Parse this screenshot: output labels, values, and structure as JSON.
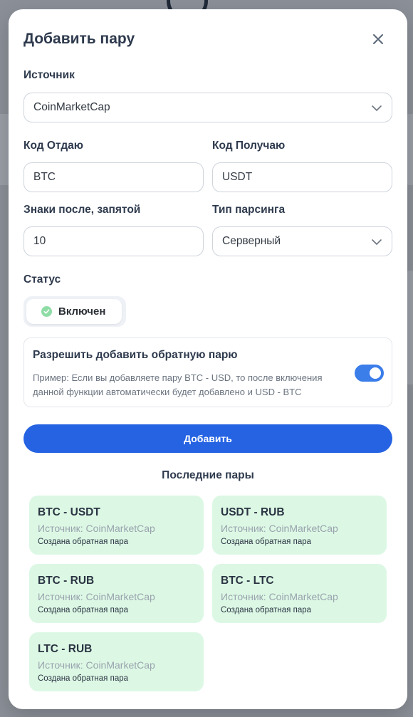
{
  "modal": {
    "title": "Добавить пару",
    "close_icon": "close-icon"
  },
  "source": {
    "label": "Источник",
    "value": "CoinMarketCap"
  },
  "give_code": {
    "label": "Код Отдаю",
    "value": "BTC"
  },
  "receive_code": {
    "label": "Код Получаю",
    "value": "USDT"
  },
  "decimals": {
    "label": "Знаки после, запятой",
    "value": "10"
  },
  "parse_type": {
    "label": "Тип парсинга",
    "value": "Серверный"
  },
  "status": {
    "label": "Статус",
    "value": "Включен",
    "color": "#8fdca6"
  },
  "reverse": {
    "title": "Разрешить добавить обратную парю",
    "description": "Пример: Если вы добавляете пару BTC - USD, то после включения данной функции автоматически будет добавлено и USD - BTC",
    "enabled": true
  },
  "add_button": {
    "label": "Добавить",
    "color": "#2563e3"
  },
  "recent": {
    "title": "Последние пары",
    "pairs": [
      {
        "name": "BTC - USDT",
        "source": "Источник: CoinMarketCap",
        "note": "Создана обратная пара"
      },
      {
        "name": "USDT - RUB",
        "source": "Источник: CoinMarketCap",
        "note": "Создана обратная пара"
      },
      {
        "name": "BTC - RUB",
        "source": "Источник: CoinMarketCap",
        "note": "Создана обратная пара"
      },
      {
        "name": "BTC - LTC",
        "source": "Источник: CoinMarketCap",
        "note": "Создана обратная пара"
      },
      {
        "name": "LTC - RUB",
        "source": "Источник: CoinMarketCap",
        "note": "Создана обратная пара"
      }
    ]
  }
}
